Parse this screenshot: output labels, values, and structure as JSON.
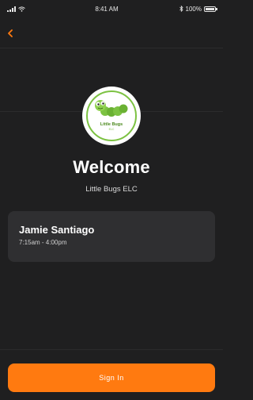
{
  "status_bar": {
    "time": "8:41 AM",
    "battery": "100%",
    "battery_level": 1.0
  },
  "nav": {
    "back_icon": "chevron-left-icon"
  },
  "school": {
    "logo_text": "Little Bugs",
    "logo_subtext": "ELC",
    "welcome": "Welcome",
    "name": "Little Bugs ELC"
  },
  "child": {
    "name": "Jamie Santiago",
    "hours": "7:15am - 4:00pm"
  },
  "actions": {
    "sign_in": "Sign In"
  },
  "colors": {
    "accent": "#ff7a10",
    "background": "#1f1f20",
    "card": "#2f2f31",
    "logo_green": "#7cc242"
  }
}
